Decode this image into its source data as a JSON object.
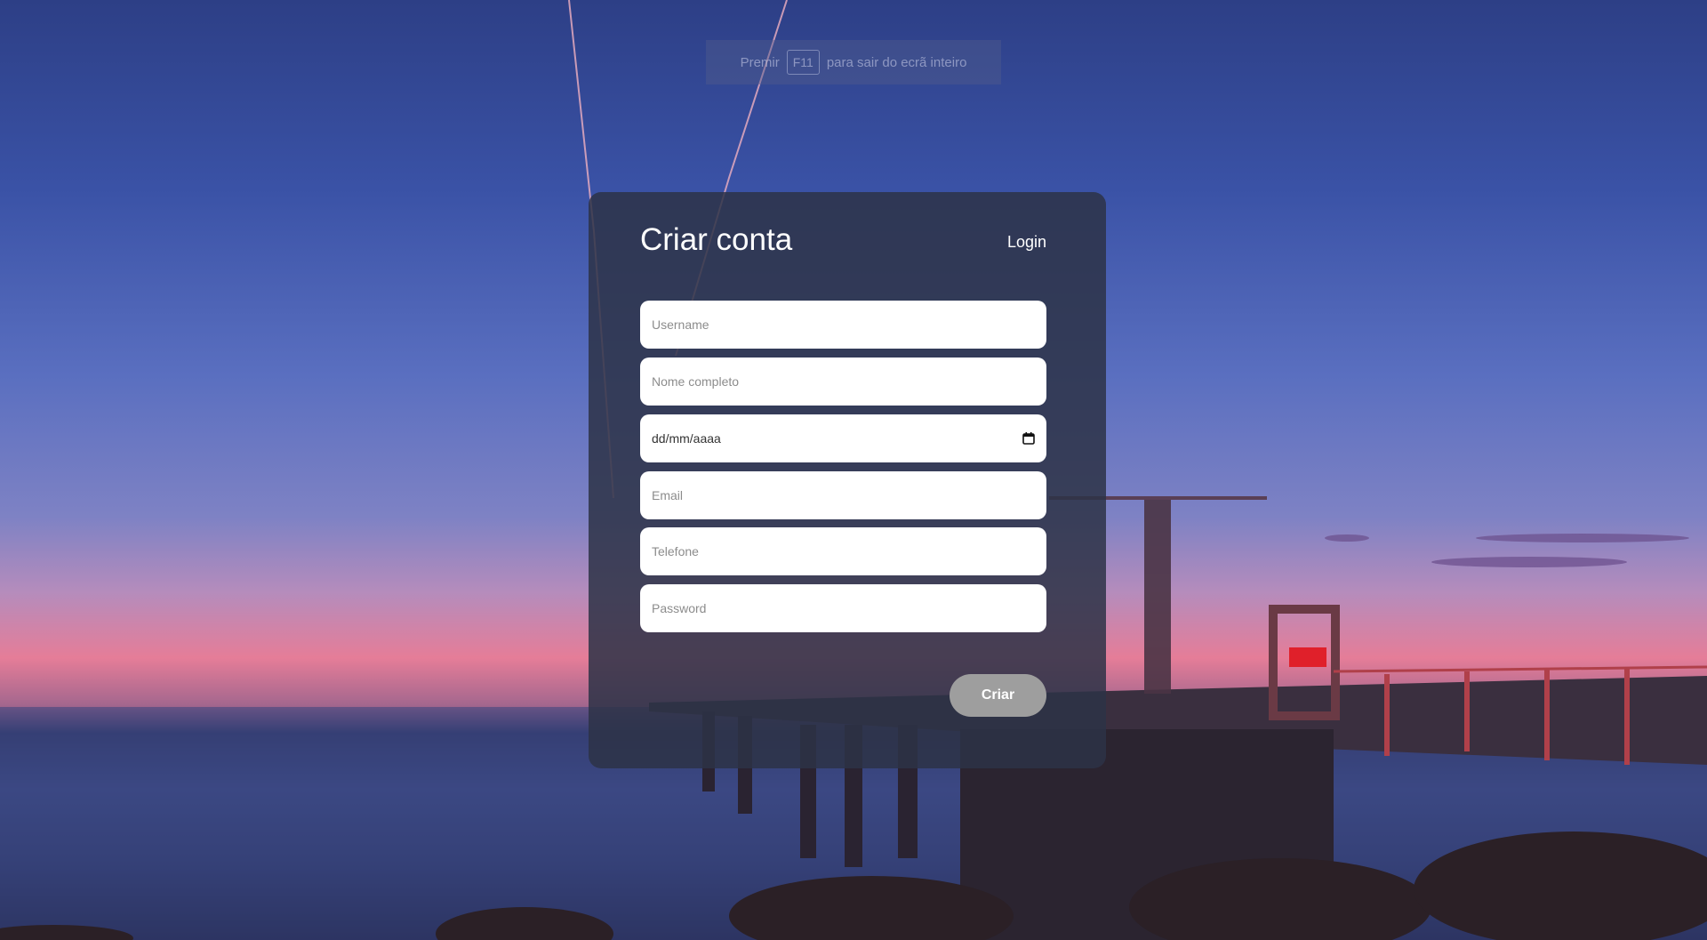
{
  "fullscreen_hint": {
    "prefix": "Premir",
    "key": "F11",
    "suffix": "para sair do ecrã inteiro"
  },
  "form": {
    "title": "Criar conta",
    "login_label": "Login",
    "fields": {
      "username_placeholder": "Username",
      "fullname_placeholder": "Nome completo",
      "birthdate_value": "dd/mm/aaaa",
      "email_placeholder": "Email",
      "phone_placeholder": "Telefone",
      "password_placeholder": "Password"
    },
    "submit_label": "Criar"
  },
  "icons": {
    "date": "calendar-icon"
  },
  "colors": {
    "card_bg": "#2d3246",
    "button_bg": "#9e9e9e",
    "field_bg": "#ffffff"
  }
}
